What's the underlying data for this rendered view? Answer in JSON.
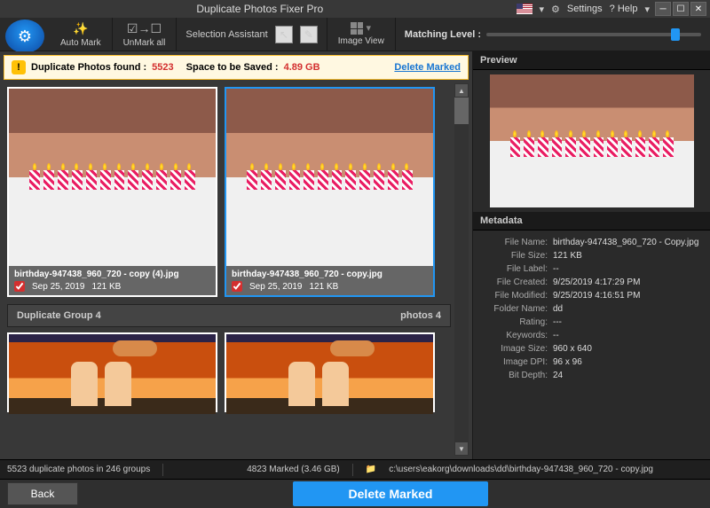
{
  "title": "Duplicate Photos Fixer Pro",
  "titlebar": {
    "settings": "Settings",
    "help": "? Help"
  },
  "toolbar": {
    "automark": "Auto Mark",
    "unmarkall": "UnMark all",
    "selection_assistant": "Selection Assistant",
    "image_view": "Image View",
    "matching_level": "Matching Level :"
  },
  "banner": {
    "found_label": "Duplicate Photos found :",
    "found_count": "5523",
    "space_label": "Space to be Saved :",
    "space_value": "4.89 GB",
    "delete_marked": "Delete Marked"
  },
  "photos": [
    {
      "name": "birthday-947438_960_720 - copy (4).jpg",
      "date": "Sep 25, 2019",
      "size": "121 KB",
      "checked": true
    },
    {
      "name": "birthday-947438_960_720 - copy.jpg",
      "date": "Sep 25, 2019",
      "size": "121 KB",
      "checked": true
    }
  ],
  "group_header": {
    "name": "Duplicate Group 4",
    "count": "photos 4"
  },
  "preview_title": "Preview",
  "metadata_title": "Metadata",
  "metadata": {
    "fileName": {
      "label": "File Name:",
      "value": "birthday-947438_960_720 - Copy.jpg"
    },
    "fileSize": {
      "label": "File Size:",
      "value": "121 KB"
    },
    "fileLabel": {
      "label": "File Label:",
      "value": "--"
    },
    "fileCreated": {
      "label": "File Created:",
      "value": "9/25/2019 4:17:29 PM"
    },
    "fileModified": {
      "label": "File Modified:",
      "value": "9/25/2019 4:16:51 PM"
    },
    "folderName": {
      "label": "Folder Name:",
      "value": "dd"
    },
    "rating": {
      "label": "Rating:",
      "value": "---"
    },
    "keywords": {
      "label": "Keywords:",
      "value": "--"
    },
    "imageSize": {
      "label": "Image Size:",
      "value": "960 x 640"
    },
    "imageDpi": {
      "label": "Image DPI:",
      "value": "96 x 96"
    },
    "bitDepth": {
      "label": "Bit Depth:",
      "value": "24"
    }
  },
  "status": {
    "summary": "5523 duplicate photos in 246 groups",
    "marked": "4823 Marked (3.46 GB)",
    "path": "c:\\users\\eakorg\\downloads\\dd\\birthday-947438_960_720 - copy.jpg"
  },
  "footer": {
    "back": "Back",
    "delete_marked": "Delete Marked"
  }
}
